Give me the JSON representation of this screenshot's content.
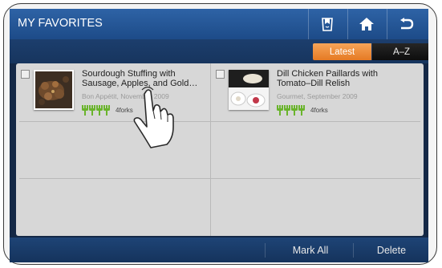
{
  "header": {
    "title": "MY FAVORITES",
    "icons": [
      "bookmark-icon",
      "home-icon",
      "back-icon"
    ]
  },
  "tabs": [
    {
      "label": "Latest",
      "active": true
    },
    {
      "label": "A–Z",
      "active": false
    }
  ],
  "recipes": [
    {
      "title": "Sourdough Stuffing with Sausage, Apples, and Gold…",
      "source": "Bon Appétit, November 2009",
      "rating_label": "4forks",
      "forks": 4
    },
    {
      "title": "Dill Chicken Paillards with Tomato–Dill Relish",
      "source": "Gourmet, September 2009",
      "rating_label": "4forks",
      "forks": 4
    }
  ],
  "footer": {
    "mark_all_label": "Mark All",
    "delete_label": "Delete"
  },
  "colors": {
    "header_blue": "#2e63a6",
    "active_tab_orange": "#f08c38",
    "fork_green": "#6ab42c"
  }
}
